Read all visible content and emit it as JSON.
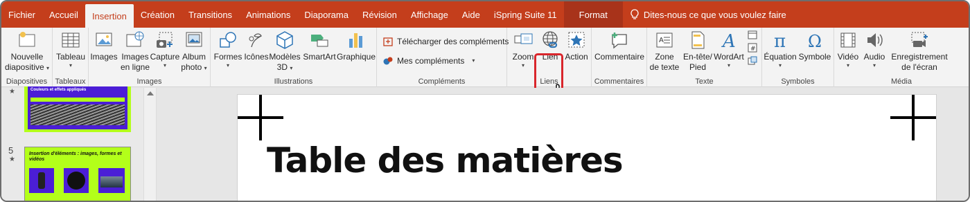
{
  "tabs": [
    {
      "label": "Fichier",
      "active": false
    },
    {
      "label": "Accueil",
      "active": false
    },
    {
      "label": "Insertion",
      "active": true
    },
    {
      "label": "Création",
      "active": false
    },
    {
      "label": "Transitions",
      "active": false
    },
    {
      "label": "Animations",
      "active": false
    },
    {
      "label": "Diaporama",
      "active": false
    },
    {
      "label": "Révision",
      "active": false
    },
    {
      "label": "Affichage",
      "active": false
    },
    {
      "label": "Aide",
      "active": false
    },
    {
      "label": "iSpring Suite 11",
      "active": false
    },
    {
      "label": "Format",
      "active": false,
      "contextual": true
    }
  ],
  "tell_me": "Dites-nous ce que vous voulez faire",
  "groups": {
    "diapositives": {
      "label": "Diapositives",
      "nouvelle_line1": "Nouvelle",
      "nouvelle_line2": "diapositive"
    },
    "tableaux": {
      "label": "Tableaux",
      "tableau": "Tableau"
    },
    "images": {
      "label": "Images",
      "images": "Images",
      "en_ligne_line1": "Images",
      "en_ligne_line2": "en ligne",
      "capture": "Capture",
      "album_line1": "Album",
      "album_line2": "photo"
    },
    "illustrations": {
      "label": "Illustrations",
      "formes": "Formes",
      "icones": "Icônes",
      "modeles_line1": "Modèles",
      "modeles_line2": "3D",
      "smartart": "SmartArt",
      "graphique": "Graphique"
    },
    "complements": {
      "label": "Compléments",
      "telecharger": "Télécharger des compléments",
      "mes": "Mes compléments"
    },
    "liens": {
      "label": "Liens",
      "zoom": "Zoom",
      "lien": "Lien",
      "action": "Action"
    },
    "commentaires": {
      "label": "Commentaires",
      "commentaire": "Commentaire"
    },
    "texte": {
      "label": "Texte",
      "zone_line1": "Zone",
      "zone_line2": "de texte",
      "entete_line1": "En-tête/",
      "entete_line2": "Pied",
      "wordart": "WordArt"
    },
    "symboles": {
      "label": "Symboles",
      "equation": "Équation",
      "symbole": "Symbole"
    },
    "media": {
      "label": "Média",
      "video": "Vidéo",
      "audio": "Audio",
      "enreg_line1": "Enregistrement",
      "enreg_line2": "de l'écran"
    }
  },
  "thumbnails": [
    {
      "number": "",
      "heading": "Couleurs et effets appliqués"
    },
    {
      "number": "5",
      "heading": "Insertion d'éléments : images, formes et vidéos"
    }
  ],
  "slide": {
    "title": "Table des matières"
  },
  "colors": {
    "accent": "#c43e1c",
    "thumb_bg": "#b3ff1a",
    "thumb_purple": "#4b1ed6",
    "highlight": "#d9262c"
  }
}
